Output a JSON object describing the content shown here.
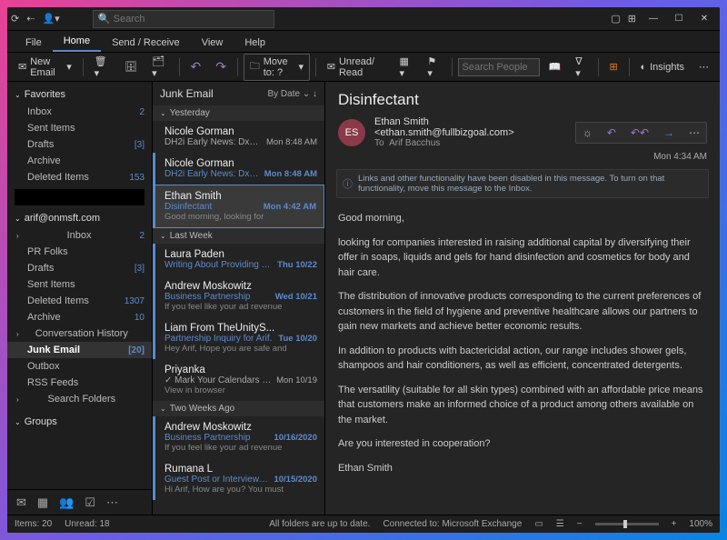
{
  "search_placeholder": "Search",
  "menutabs": [
    "File",
    "Home",
    "Send / Receive",
    "View",
    "Help"
  ],
  "menutabs_active": 1,
  "ribbon": {
    "new_email": "New Email",
    "move_to": "Move to: ?",
    "unread_read": "Unread/ Read",
    "search_people": "Search People",
    "insights": "Insights"
  },
  "nav": {
    "favorites": "Favorites",
    "fav_items": [
      {
        "name": "Inbox",
        "count": "2"
      },
      {
        "name": "Sent Items",
        "count": ""
      },
      {
        "name": "Drafts",
        "count": "[3]"
      },
      {
        "name": "Archive",
        "count": ""
      },
      {
        "name": "Deleted Items",
        "count": "153"
      }
    ],
    "account": "arif@onmsft.com",
    "acct_items": [
      {
        "name": "Inbox",
        "count": "2",
        "sel": false,
        "expand": true
      },
      {
        "name": "PR Folks",
        "count": "",
        "sel": false
      },
      {
        "name": "Drafts",
        "count": "[3]",
        "sel": false
      },
      {
        "name": "Sent Items",
        "count": "",
        "sel": false
      },
      {
        "name": "Deleted Items",
        "count": "1307",
        "sel": false
      },
      {
        "name": "Archive",
        "count": "10",
        "sel": false
      },
      {
        "name": "Conversation History",
        "count": "",
        "sel": false,
        "expand": true
      },
      {
        "name": "Junk Email",
        "count": "[20]",
        "sel": true
      },
      {
        "name": "Outbox",
        "count": "",
        "sel": false
      },
      {
        "name": "RSS Feeds",
        "count": "",
        "sel": false
      },
      {
        "name": "Search Folders",
        "count": "",
        "sel": false,
        "expand": true
      }
    ],
    "groups": "Groups"
  },
  "msglist": {
    "title": "Junk Email",
    "sort": "By Date",
    "groups": [
      {
        "label": "Yesterday",
        "rows": [
          {
            "from": "Nicole Gorman",
            "subj": "DH2i Early News: DxOdyssey f...",
            "date": "Mon 8:48 AM",
            "prev": "",
            "unread": false
          },
          {
            "from": "Nicole Gorman",
            "subj": "DH2i Early News: DxOdysse...",
            "date": "Mon 8:48 AM",
            "prev": "",
            "unread": true
          },
          {
            "from": "Ethan Smith",
            "subj": "Disinfectant",
            "date": "Mon 4:42 AM",
            "prev": "Good morning,  looking for",
            "unread": true,
            "sel": true
          }
        ]
      },
      {
        "label": "Last Week",
        "rows": [
          {
            "from": "Laura Paden",
            "subj": "Writing About Providing To...",
            "date": "Thu 10/22",
            "prev": "",
            "unread": true
          },
          {
            "from": "Andrew Moskowitz",
            "subj": "Business Partnership",
            "date": "Wed 10/21",
            "prev": "If you feel like your ad revenue",
            "unread": true
          },
          {
            "from": "Liam From TheUnityS...",
            "subj": "Partnership Inquiry for Arif.",
            "date": "Tue 10/20",
            "prev": "Hey Arif,  Hope you are safe and",
            "unread": true
          },
          {
            "from": "Priyanka",
            "subj": "✓ Mark Your Calendars to M...",
            "date": "Mon 10/19",
            "prev": "View in browser",
            "unread": false
          }
        ]
      },
      {
        "label": "Two Weeks Ago",
        "rows": [
          {
            "from": "Andrew Moskowitz",
            "subj": "Business Partnership",
            "date": "10/16/2020",
            "prev": "If you feel like your ad revenue",
            "unread": true
          },
          {
            "from": "Rumana L",
            "subj": "Guest Post or Interview opp...",
            "date": "10/15/2020",
            "prev": "Hi Arif,  How are you?  You must",
            "unread": true
          }
        ]
      }
    ]
  },
  "reading": {
    "subject": "Disinfectant",
    "avatar": "ES",
    "from": "Ethan Smith <ethan.smith@fullbizgoal.com>",
    "to_label": "To",
    "to": "Arif Bacchus",
    "time": "Mon 4:34 AM",
    "info": "Links and other functionality have been disabled in this message. To turn on that functionality, move this message to the Inbox.",
    "body": [
      "Good morning,",
      "looking for companies interested in raising additional capital by diversifying their offer in soaps, liquids and gels for hand disinfection and cosmetics for body and hair care.",
      "The distribution of innovative products corresponding to the current preferences of customers in the field of hygiene and preventive healthcare allows our partners to gain new markets and achieve better economic results.",
      "In addition to products with bactericidal action, our range includes shower gels, shampoos and hair conditioners, as well as efficient, concentrated detergents.",
      "The versatility (suitable for all skin types) combined with an affordable price means that customers make an informed choice of a product among others available on the market.",
      "Are you interested in cooperation?",
      "Ethan Smith"
    ]
  },
  "status": {
    "items": "Items: 20",
    "unread": "Unread: 18",
    "uptodate": "All folders are up to date.",
    "connected": "Connected to: Microsoft Exchange",
    "zoom": "100%"
  }
}
